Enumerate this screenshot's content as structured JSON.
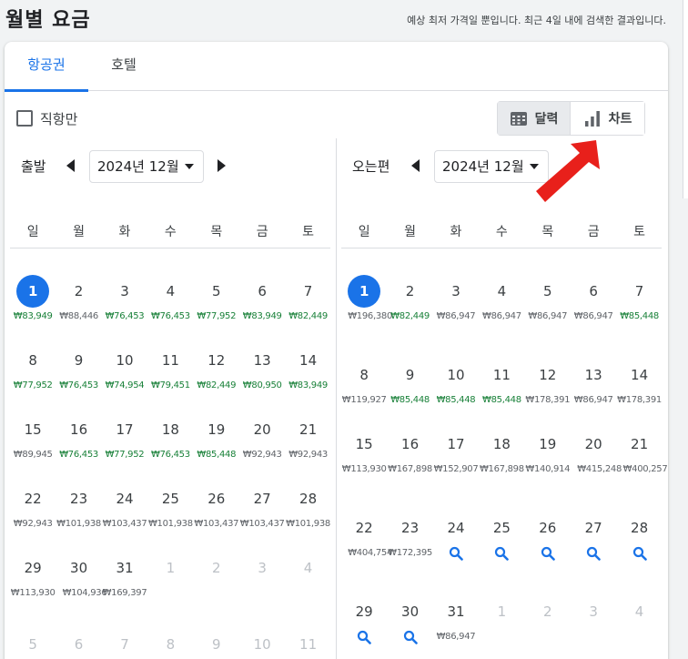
{
  "header": {
    "title": "월별 요금",
    "subtitle": "예상 최저 가격일 뿐입니다. 최근 4일 내에 검색한 결과입니다."
  },
  "tabs": [
    {
      "label": "항공권",
      "active": true
    },
    {
      "label": "호텔",
      "active": false
    }
  ],
  "filters": {
    "nonstop_label": "직항만",
    "nonstop_checked": false
  },
  "view_toggle": {
    "calendar_label": "달력",
    "chart_label": "차트",
    "selected": "calendar"
  },
  "departure": {
    "label": "출발",
    "month": "2024년 12월",
    "weekdays": [
      "일",
      "월",
      "화",
      "수",
      "목",
      "금",
      "토"
    ],
    "days": [
      {
        "day": "1",
        "price": "₩83,949",
        "low": true,
        "selected": true
      },
      {
        "day": "2",
        "price": "₩88,446",
        "low": false
      },
      {
        "day": "3",
        "price": "₩76,453",
        "low": true
      },
      {
        "day": "4",
        "price": "₩76,453",
        "low": true
      },
      {
        "day": "5",
        "price": "₩77,952",
        "low": true
      },
      {
        "day": "6",
        "price": "₩83,949",
        "low": true
      },
      {
        "day": "7",
        "price": "₩82,449",
        "low": true
      },
      {
        "day": "8",
        "price": "₩77,952",
        "low": true
      },
      {
        "day": "9",
        "price": "₩76,453",
        "low": true
      },
      {
        "day": "10",
        "price": "₩74,954",
        "low": true
      },
      {
        "day": "11",
        "price": "₩79,451",
        "low": true
      },
      {
        "day": "12",
        "price": "₩82,449",
        "low": true
      },
      {
        "day": "13",
        "price": "₩80,950",
        "low": true
      },
      {
        "day": "14",
        "price": "₩83,949",
        "low": true
      },
      {
        "day": "15",
        "price": "₩89,945",
        "low": false
      },
      {
        "day": "16",
        "price": "₩76,453",
        "low": true
      },
      {
        "day": "17",
        "price": "₩77,952",
        "low": true
      },
      {
        "day": "18",
        "price": "₩76,453",
        "low": true
      },
      {
        "day": "19",
        "price": "₩85,448",
        "low": true
      },
      {
        "day": "20",
        "price": "₩92,943",
        "low": false
      },
      {
        "day": "21",
        "price": "₩92,943",
        "low": false
      },
      {
        "day": "22",
        "price": "₩92,943",
        "low": false
      },
      {
        "day": "23",
        "price": "₩101,938",
        "low": false
      },
      {
        "day": "24",
        "price": "₩103,437",
        "low": false
      },
      {
        "day": "25",
        "price": "₩101,938",
        "low": false
      },
      {
        "day": "26",
        "price": "₩103,437",
        "low": false
      },
      {
        "day": "27",
        "price": "₩103,437",
        "low": false
      },
      {
        "day": "28",
        "price": "₩101,938",
        "low": false
      },
      {
        "day": "29",
        "price": "₩113,930",
        "low": false
      },
      {
        "day": "30",
        "price": "₩104,936",
        "low": false,
        "wrap": true
      },
      {
        "day": "31",
        "price": "₩169,397",
        "low": false
      },
      {
        "day": "1",
        "muted": true
      },
      {
        "day": "2",
        "muted": true
      },
      {
        "day": "3",
        "muted": true
      },
      {
        "day": "4",
        "muted": true
      },
      {
        "day": "5",
        "muted": true
      },
      {
        "day": "6",
        "muted": true
      },
      {
        "day": "7",
        "muted": true
      },
      {
        "day": "8",
        "muted": true
      },
      {
        "day": "9",
        "muted": true
      },
      {
        "day": "10",
        "muted": true
      },
      {
        "day": "11",
        "muted": true
      }
    ]
  },
  "return": {
    "label": "오는편",
    "month": "2024년 12월",
    "weekdays": [
      "일",
      "월",
      "화",
      "수",
      "목",
      "금",
      "토"
    ],
    "days": [
      {
        "day": "1",
        "price": "₩196,380",
        "low": false,
        "selected": true,
        "wrap": true
      },
      {
        "day": "2",
        "price": "₩82,449",
        "low": true
      },
      {
        "day": "3",
        "price": "₩86,947",
        "low": false
      },
      {
        "day": "4",
        "price": "₩86,947",
        "low": false
      },
      {
        "day": "5",
        "price": "₩86,947",
        "low": false
      },
      {
        "day": "6",
        "price": "₩86,947",
        "low": false
      },
      {
        "day": "7",
        "price": "₩85,448",
        "low": true
      },
      {
        "day": "8",
        "price": "₩119,927",
        "low": false
      },
      {
        "day": "9",
        "price": "₩85,448",
        "low": true
      },
      {
        "day": "10",
        "price": "₩85,448",
        "low": true
      },
      {
        "day": "11",
        "price": "₩85,448",
        "low": true
      },
      {
        "day": "12",
        "price": "₩178,391",
        "low": false
      },
      {
        "day": "13",
        "price": "₩86,947",
        "low": false
      },
      {
        "day": "14",
        "price": "₩178,391",
        "low": false
      },
      {
        "day": "15",
        "price": "₩113,930",
        "low": false
      },
      {
        "day": "16",
        "price": "₩167,898",
        "low": false
      },
      {
        "day": "17",
        "price": "₩152,907",
        "low": false
      },
      {
        "day": "18",
        "price": "₩167,898",
        "low": false
      },
      {
        "day": "19",
        "price": "₩140,914",
        "low": false
      },
      {
        "day": "20",
        "price": "₩415,248",
        "low": false,
        "wrap": true
      },
      {
        "day": "21",
        "price": "₩400,257",
        "low": false,
        "wrap": true
      },
      {
        "day": "22",
        "price": "₩404,754",
        "low": false,
        "wrap": true
      },
      {
        "day": "23",
        "price": "₩172,395",
        "low": false
      },
      {
        "day": "24",
        "search": true
      },
      {
        "day": "25",
        "search": true
      },
      {
        "day": "26",
        "search": true
      },
      {
        "day": "27",
        "search": true
      },
      {
        "day": "28",
        "search": true
      },
      {
        "day": "29",
        "search": true
      },
      {
        "day": "30",
        "search": true
      },
      {
        "day": "31",
        "price": "₩86,947",
        "low": false
      },
      {
        "day": "1",
        "muted": true
      },
      {
        "day": "2",
        "muted": true
      },
      {
        "day": "3",
        "muted": true
      },
      {
        "day": "4",
        "muted": true
      }
    ]
  },
  "colors": {
    "accent": "#1a73e8",
    "low_price": "#188038",
    "annotation_arrow": "#e8201b"
  },
  "icons": {
    "calendar": "calendar-icon",
    "chart": "bar-chart-icon",
    "search": "search-icon",
    "prev": "triangle-left-icon",
    "next": "triangle-right-icon"
  }
}
